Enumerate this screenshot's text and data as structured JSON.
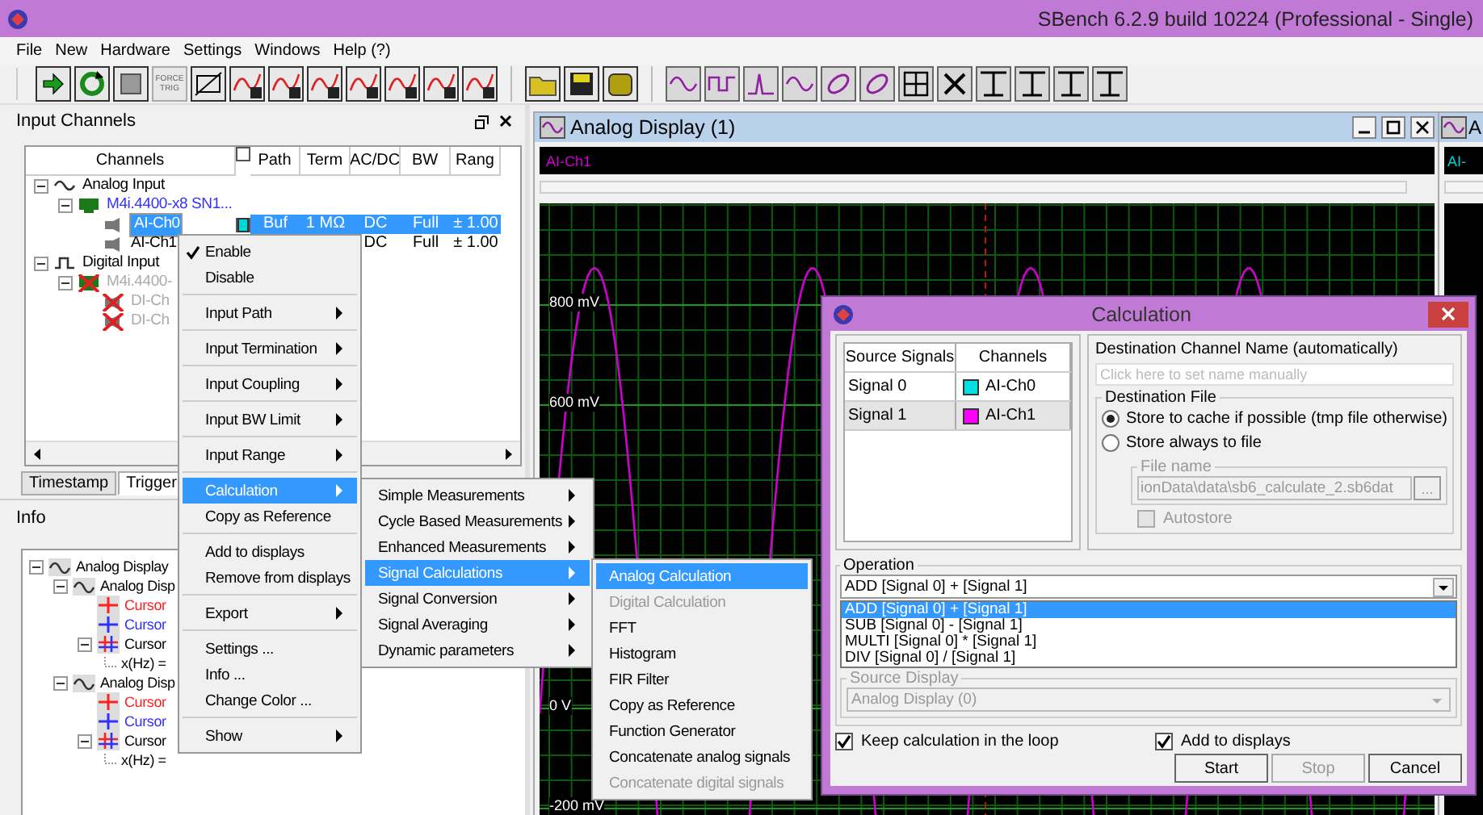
{
  "window": {
    "title": "SBench 6.2.9 build 10224 (Professional - Single)"
  },
  "menu": [
    "File",
    "New",
    "Hardware",
    "Settings",
    "Windows",
    "Help (?)"
  ],
  "toolbar": {
    "force_trigger_label": "FORCE TRIG"
  },
  "input_channels": {
    "title": "Input Channels",
    "columns": [
      "Channels",
      "Path",
      "Term",
      "AC/DC",
      "BW",
      "Rang"
    ],
    "tree": [
      {
        "label": "Analog Input",
        "kind": "analog-group",
        "expanded": true,
        "disabled": false,
        "selected": false,
        "children": [
          {
            "label": "M4i.4400-x8 SN1...",
            "kind": "device",
            "expanded": true,
            "disabled": false,
            "selected": false,
            "children": [
              {
                "label": "AI-Ch0",
                "kind": "channel",
                "disabled": false,
                "selected": true,
                "color": "#00d8d8",
                "path": "Buf",
                "term": "1 MΩ",
                "coupling": "DC",
                "bandwidth": "Full",
                "range": "± 1.00"
              },
              {
                "label": "AI-Ch1",
                "kind": "channel",
                "disabled": false,
                "selected": false,
                "coupling": "DC",
                "bandwidth": "Full",
                "range": "± 1.00"
              }
            ]
          }
        ]
      },
      {
        "label": "Digital Input",
        "kind": "digital-group",
        "expanded": true,
        "disabled": false,
        "selected": false,
        "children": [
          {
            "label": "M4i.4400-",
            "kind": "device",
            "expanded": true,
            "disabled": true,
            "selected": false,
            "children": [
              {
                "label": "DI-Ch",
                "kind": "channel",
                "disabled": true,
                "selected": false
              },
              {
                "label": "DI-Ch",
                "kind": "channel",
                "disabled": true,
                "selected": false
              }
            ]
          }
        ]
      }
    ]
  },
  "tabs": [
    {
      "label": "Timestamp",
      "selected": false
    },
    {
      "label": "Trigger",
      "selected": true
    }
  ],
  "info": {
    "title": "Info",
    "tree": [
      {
        "label": "Analog Display",
        "kind": "display",
        "expanded": true,
        "children": [
          {
            "label": "Analog Disp",
            "kind": "display",
            "expanded": true,
            "children": [
              {
                "label": "Cursor",
                "kind": "cursor-a",
                "color": "#ff2020"
              },
              {
                "label": "Cursor",
                "kind": "cursor-b",
                "color": "#3030ff"
              },
              {
                "label": "Cursor",
                "kind": "cursor-pair",
                "color": "#000000",
                "expanded": true,
                "children": [
                  {
                    "label": "x(Hz) =",
                    "kind": "value"
                  }
                ]
              }
            ]
          },
          {
            "label": "Analog Disp",
            "kind": "display",
            "expanded": true,
            "children": [
              {
                "label": "Cursor",
                "kind": "cursor-a",
                "color": "#ff2020"
              },
              {
                "label": "Cursor",
                "kind": "cursor-b",
                "color": "#3030ff"
              },
              {
                "label": "Cursor",
                "kind": "cursor-pair",
                "color": "#000000",
                "expanded": true,
                "children": [
                  {
                    "label": "x(Hz) =",
                    "kind": "value"
                  }
                ]
              }
            ]
          }
        ]
      }
    ]
  },
  "context_menu": {
    "groups": [
      [
        {
          "label": "Enable",
          "checked": true,
          "submenu": false,
          "selected": false
        },
        {
          "label": "Disable",
          "checked": false,
          "submenu": false,
          "selected": false
        }
      ],
      [
        {
          "label": "Input Path",
          "checked": false,
          "submenu": true,
          "selected": false
        }
      ],
      [
        {
          "label": "Input Termination",
          "checked": false,
          "submenu": true,
          "selected": false
        }
      ],
      [
        {
          "label": "Input Coupling",
          "checked": false,
          "submenu": true,
          "selected": false
        }
      ],
      [
        {
          "label": "Input BW Limit",
          "checked": false,
          "submenu": true,
          "selected": false
        }
      ],
      [
        {
          "label": "Input Range",
          "checked": false,
          "submenu": true,
          "selected": false
        }
      ],
      [
        {
          "label": "Calculation",
          "checked": false,
          "submenu": true,
          "selected": true
        },
        {
          "label": "Copy as Reference",
          "checked": false,
          "submenu": false,
          "selected": false
        }
      ],
      [
        {
          "label": "Add to displays",
          "checked": false,
          "submenu": false,
          "selected": false
        },
        {
          "label": "Remove from displays",
          "checked": false,
          "submenu": false,
          "selected": false
        }
      ],
      [
        {
          "label": "Export",
          "checked": false,
          "submenu": true,
          "selected": false
        }
      ],
      [
        {
          "label": "Settings ...",
          "checked": false,
          "submenu": false,
          "selected": false
        },
        {
          "label": "Info ...",
          "checked": false,
          "submenu": false,
          "selected": false
        },
        {
          "label": "Change Color ...",
          "checked": false,
          "submenu": false,
          "selected": false
        }
      ],
      [
        {
          "label": "Show",
          "checked": false,
          "submenu": true,
          "selected": false
        }
      ]
    ]
  },
  "calculation_menu": [
    {
      "label": "Simple Measurements",
      "selected": false
    },
    {
      "label": "Cycle Based Measurements",
      "selected": false
    },
    {
      "label": "Enhanced Measurements",
      "selected": false
    },
    {
      "label": "Signal Calculations",
      "selected": true
    },
    {
      "label": "Signal Conversion",
      "selected": false
    },
    {
      "label": "Signal Averaging",
      "selected": false
    },
    {
      "label": "Dynamic parameters",
      "selected": false
    }
  ],
  "signal_calculations_menu": [
    {
      "label": "Analog Calculation",
      "selected": true,
      "disabled": false
    },
    {
      "label": "Digital Calculation",
      "selected": false,
      "disabled": true
    },
    {
      "label": "FFT",
      "selected": false,
      "disabled": false
    },
    {
      "label": "Histogram",
      "selected": false,
      "disabled": false
    },
    {
      "label": "FIR Filter",
      "selected": false,
      "disabled": false
    },
    {
      "label": "Copy as Reference",
      "selected": false,
      "disabled": false
    },
    {
      "label": "Function Generator",
      "selected": false,
      "disabled": false
    },
    {
      "label": "Concatenate analog signals",
      "selected": false,
      "disabled": false
    },
    {
      "label": "Concatenate digital signals",
      "selected": false,
      "disabled": true
    }
  ],
  "displays": [
    {
      "title": "Analog Display (1)",
      "channel": {
        "label": "AI-Ch1",
        "color": "#d000d0"
      },
      "y_labels": [
        "800 mV",
        "600 mV",
        "0 V",
        "-200 mV"
      ]
    },
    {
      "title": "A",
      "channel": {
        "label": "AI-",
        "color": "#00d0d0"
      }
    }
  ],
  "dialog": {
    "title": "Calculation",
    "source_columns": [
      "Source Signals",
      "Channels"
    ],
    "sources": [
      {
        "signal": "Signal 0",
        "channel": "AI-Ch0",
        "color": "#00e0e0",
        "selected": false
      },
      {
        "signal": "Signal 1",
        "channel": "AI-Ch1",
        "color": "#ff00ff",
        "selected": true
      }
    ],
    "destination_label": "Destination Channel Name (automatically)",
    "destination_placeholder": "Click here to set name manually",
    "file_group": "Destination File",
    "store_options": [
      {
        "label": "Store to cache if possible (tmp file otherwise)",
        "selected": true
      },
      {
        "label": "Store always to file",
        "selected": false
      }
    ],
    "file_name_group": "File name",
    "file_name": "ionData\\data\\sb6_calculate_2.sb6dat",
    "browse": "...",
    "autostore": {
      "label": "Autostore",
      "checked": false,
      "disabled": true
    },
    "operation_group": "Operation",
    "operation": "ADD [Signal 0] + [Signal 1]",
    "operations": [
      {
        "label": "ADD [Signal 0] + [Signal 1]",
        "selected": true
      },
      {
        "label": "SUB [Signal 0] - [Signal 1]",
        "selected": false
      },
      {
        "label": "MULTI [Signal 0] * [Signal 1]",
        "selected": false
      },
      {
        "label": "DIV [Signal 0] / [Signal 1]",
        "selected": false
      }
    ],
    "source_display_group": "Source Display",
    "source_display": "Analog Display (0)",
    "keep_in_loop": {
      "label": "Keep calculation in the loop",
      "checked": true
    },
    "add_to_displays": {
      "label": "Add to displays",
      "checked": true
    },
    "buttons": [
      {
        "label": "Start",
        "disabled": false
      },
      {
        "label": "Stop",
        "disabled": true
      },
      {
        "label": "Cancel",
        "disabled": false
      }
    ]
  }
}
